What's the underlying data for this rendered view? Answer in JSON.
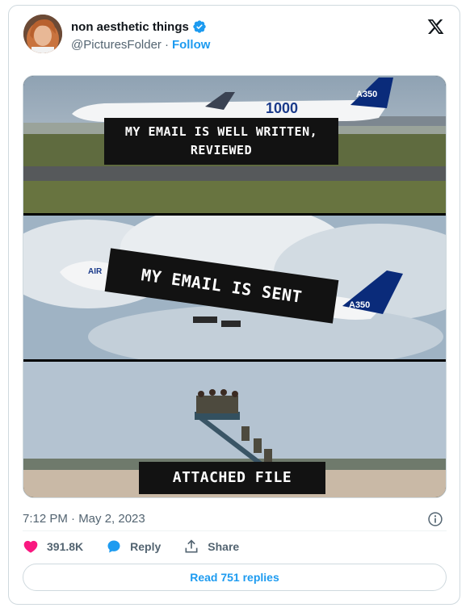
{
  "author": {
    "display_name": "non aesthetic things",
    "handle": "@PicturesFolder",
    "separator": "·",
    "follow_label": "Follow"
  },
  "media": {
    "panels": [
      {
        "caption": "MY EMAIL IS WELL WRITTEN, REVIEWED",
        "tail_text": "A350",
        "fuselage_text": "1000"
      },
      {
        "caption": "MY EMAIL IS SENT",
        "tail_text": "A350",
        "fuselage_text": "AIR"
      },
      {
        "caption": "ATTACHED FILE"
      }
    ]
  },
  "timestamp": "7:12 PM · May 2, 2023",
  "actions": {
    "likes": "391.8K",
    "reply_label": "Reply",
    "share_label": "Share"
  },
  "read_replies_label": "Read 751 replies",
  "colors": {
    "accent": "#1d9bf0",
    "like": "#f91880",
    "muted": "#536471"
  }
}
